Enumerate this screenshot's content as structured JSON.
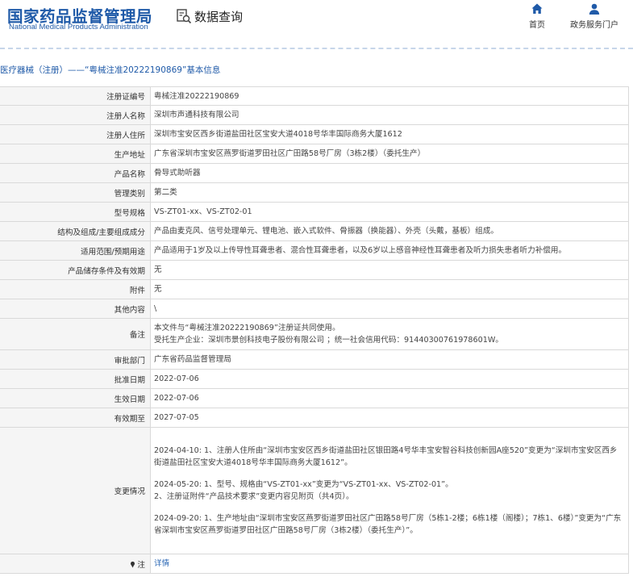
{
  "header": {
    "logo_cn": "国家药品监督管理局",
    "logo_en": "National Medical Products Administration",
    "query_label": "数据查询",
    "nav": {
      "home": "首页",
      "portal": "政务服务门户"
    }
  },
  "breadcrumb": "医疗器械（注册）——“粤械注准20222190869”基本信息",
  "rows": [
    {
      "key": "注册证编号",
      "value": "粤械注准20222190869"
    },
    {
      "key": "注册人名称",
      "value": "深圳市声通科技有限公司"
    },
    {
      "key": "注册人住所",
      "value": "深圳市宝安区西乡街道盐田社区宝安大道4018号华丰国际商务大厦1612"
    },
    {
      "key": "生产地址",
      "value": "广东省深圳市宝安区燕罗街道罗田社区广田路58号厂房（3栋2楼）（委托生产）"
    },
    {
      "key": "产品名称",
      "value": "骨导式助听器"
    },
    {
      "key": "管理类别",
      "value": "第二类"
    },
    {
      "key": "型号规格",
      "value": "VS-ZT01-xx、VS-ZT02-01"
    },
    {
      "key": "结构及组成/主要组成成分",
      "value": "产品由麦克风、信号处理单元、锂电池、嵌入式软件、骨振器（换能器）、外壳（头戴，基板）组成。"
    },
    {
      "key": "适用范围/预期用途",
      "value": "产品适用于1岁及以上传导性耳聋患者、混合性耳聋患者，以及6岁以上感音神经性耳聋患者及听力损失患者听力补偿用。"
    },
    {
      "key": "产品储存条件及有效期",
      "value": "无"
    },
    {
      "key": "附件",
      "value": "无"
    },
    {
      "key": "其他内容",
      "value": "\\"
    }
  ],
  "remark": {
    "key": "备注",
    "line1": "本文件与“粤械注准20222190869”注册证共同使用。",
    "line2": "受托生产企业：深圳市景创科技电子股份有限公司 ；统一社会信用代码：91440300761978601W。"
  },
  "rows2": [
    {
      "key": "审批部门",
      "value": "广东省药品监督管理局"
    },
    {
      "key": "批准日期",
      "value": "2022-07-06"
    },
    {
      "key": "生效日期",
      "value": "2022-07-06"
    },
    {
      "key": "有效期至",
      "value": "2027-07-05"
    }
  ],
  "changes": {
    "key": "变更情况",
    "block1": "2024-04-10: 1、注册人住所由“深圳市宝安区西乡街道盐田社区银田路4号华丰宝安智谷科技创新园A座520”变更为“深圳市宝安区西乡街道盐田社区宝安大道4018号华丰国际商务大厦1612”。",
    "block2_line1": "2024-05-20: 1、型号、规格由“VS-ZT01-xx”变更为“VS-ZT01-xx、VS-ZT02-01”。",
    "block2_line2": "2、注册证附件“产品技术要求”变更内容见附页（共4页）。",
    "block3": "2024-09-20: 1、生产地址由“深圳市宝安区燕罗街道罗田社区广田路58号厂房（5栋1-2楼；6栋1楼（阁楼）；7栋1、6楼）”变更为“广东省深圳市宝安区燕罗街道罗田社区广田路58号厂房（3栋2楼）（委托生产）”。"
  },
  "note": {
    "key": "注",
    "value": "详情"
  },
  "colors": {
    "brand": "#1f5aa8",
    "link": "#2c68b5",
    "key_bg": "#f5f5f5",
    "border": "#d9d9d9"
  },
  "icons": [
    "search-doc-icon",
    "home-icon",
    "user-icon",
    "pin-icon"
  ]
}
